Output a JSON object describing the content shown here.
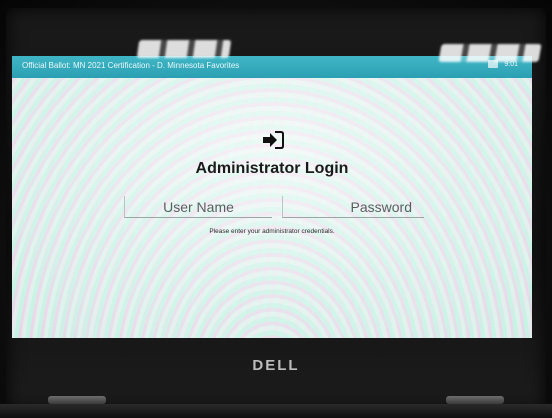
{
  "app": {
    "title": "Official Ballot: MN 2021 Certification - D. Minnesota Favorites",
    "status_text": "9:01"
  },
  "login": {
    "icon": "sign-in-icon",
    "heading": "Administrator Login",
    "username_placeholder": "User Name",
    "password_placeholder": "Password",
    "hint": "Please enter your administrator credentials."
  },
  "device": {
    "brand": "DELL"
  },
  "colors": {
    "topbar": "#2aa0b2",
    "screen_bg": "#dfeee8",
    "text": "#1b1b1b"
  }
}
